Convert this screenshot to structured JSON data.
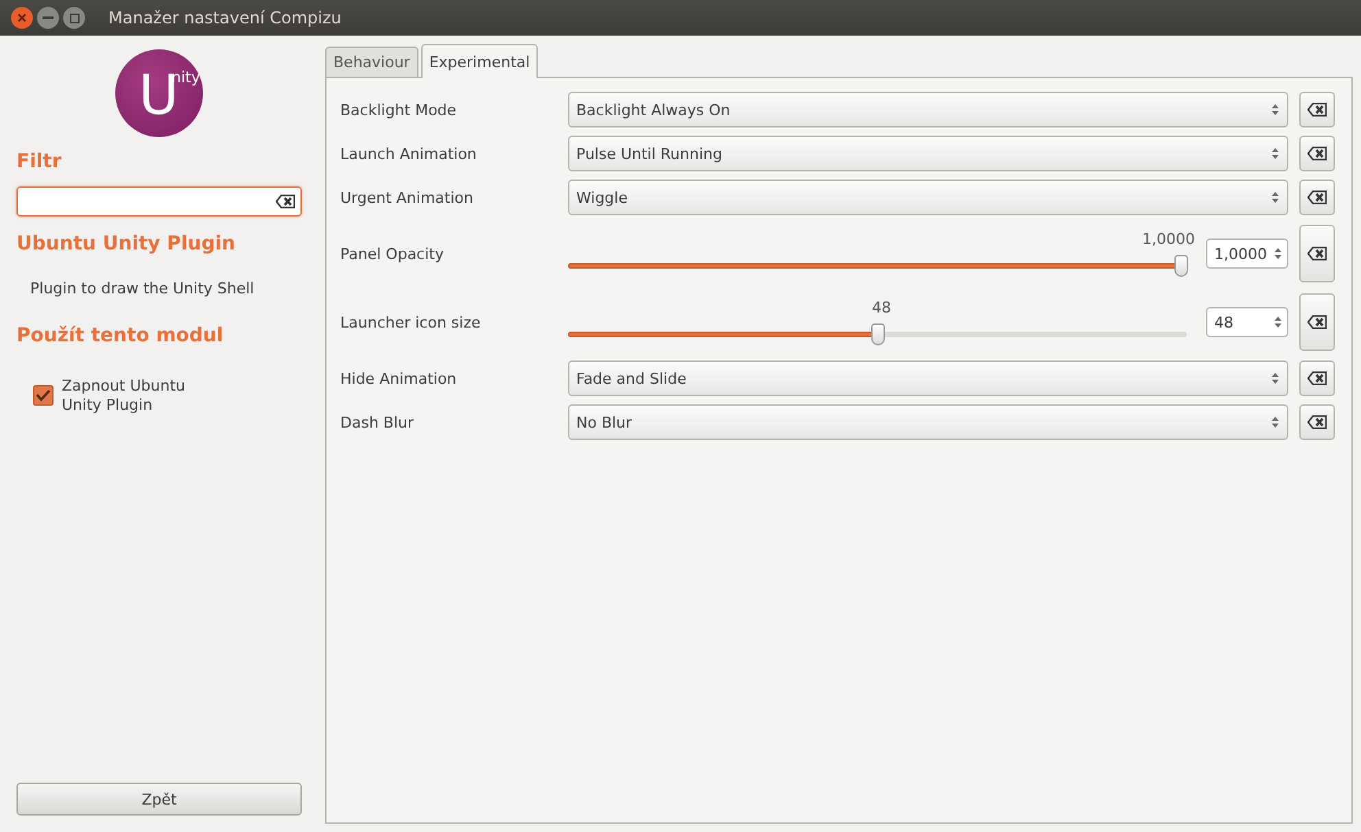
{
  "window": {
    "title": "Manažer nastavení Compizu"
  },
  "sidebar": {
    "logo": {
      "big": "U",
      "small": "nity"
    },
    "filter_heading": "Filtr",
    "plugin_heading": "Ubuntu Unity Plugin",
    "plugin_description": "Plugin to draw the Unity Shell",
    "use_heading": "Použít tento modul",
    "enable": {
      "label": "Zapnout Ubuntu Unity Plugin",
      "checked": true
    },
    "back_button": "Zpět"
  },
  "tabs": [
    {
      "label": "Behaviour",
      "selected": false
    },
    {
      "label": "Experimental",
      "selected": true
    }
  ],
  "settings": [
    {
      "kind": "combo",
      "label": "Backlight Mode",
      "value": "Backlight Always On"
    },
    {
      "kind": "combo",
      "label": "Launch Animation",
      "value": "Pulse Until Running"
    },
    {
      "kind": "combo",
      "label": "Urgent Animation",
      "value": "Wiggle"
    },
    {
      "kind": "slider",
      "label": "Panel Opacity",
      "level": 1.0,
      "reading": "1,0000",
      "value": "1,0000"
    },
    {
      "kind": "slider",
      "label": "Launcher icon size",
      "level": 0.5,
      "reading": "48",
      "value": "48"
    },
    {
      "kind": "combo",
      "label": "Hide Animation",
      "value": "Fade and Slide"
    },
    {
      "kind": "combo",
      "label": "Dash Blur",
      "value": "No Blur"
    }
  ]
}
